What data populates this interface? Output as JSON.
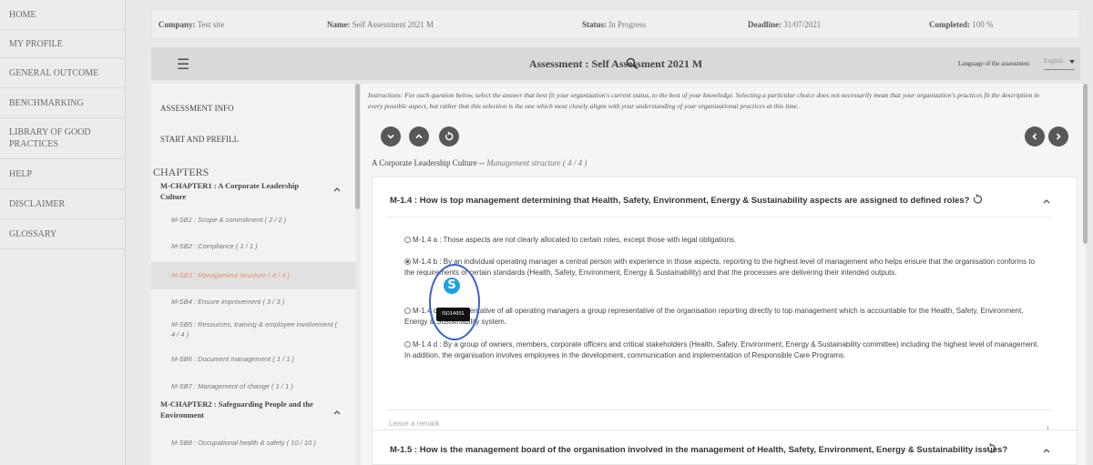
{
  "nav": {
    "items": [
      {
        "label": "HOME"
      },
      {
        "label": "MY PROFILE"
      },
      {
        "label": "GENERAL OUTCOME"
      },
      {
        "label": "BENCHMARKING"
      },
      {
        "label": "LIBRARY OF GOOD PRACTICES"
      },
      {
        "label": "HELP"
      },
      {
        "label": "DISCLAIMER"
      },
      {
        "label": "GLOSSARY"
      }
    ]
  },
  "info": {
    "company_label": "Company:",
    "company": "Test site",
    "name_label": "Name:",
    "name": "Self Assessment 2021 M",
    "status_label": "Status:",
    "status": "In Progress",
    "deadline_label": "Deadline:",
    "deadline": "31/07/2021",
    "completed_label": "Completed:",
    "completed": "100 %"
  },
  "header": {
    "title": "Assessment : Self Assessment 2021 M",
    "language_label": "Language of the assessment",
    "language_value": "English"
  },
  "sidebar": {
    "assessment_info": "ASSESSMENT INFO",
    "start_prefill": "START AND PREFILL",
    "chapters_heading": "CHAPTERS",
    "chapter1": "M-CHAPTER1 : A Corporate Leadership Culture",
    "sb_items": [
      "M-SB1 : Scope & commitment ( 2 / 2 )",
      "M-SB2 : Compliance ( 1 / 1 )",
      "M-SB3 : Management structure ( 4 / 4 )",
      "M-SB4 : Ensure improvement ( 3 / 3 )",
      "M-SB5 : Resources, training & employee involvement ( 4 / 4 )",
      "M-SB6 : Document management ( 1 / 1 )",
      "M-SB7 : Management of change ( 1 / 1 )"
    ],
    "active_sb_index": 2,
    "chapter2": "M-CHAPTER2 : Safeguarding People and the Environment",
    "sb8": "M-SB8 : Occupational health & safety ( 10 / 10 )"
  },
  "main": {
    "instructions": "Instructions: For each question below, select the answer that best fit your organization's current status, to the best of your knowledge. Selecting a particular choice does not necessarily mean that your organization's practices fit the description in every possible aspect, but rather that this selection is the one which most closely aligns with your understanding of your organizational practices at this time.",
    "breadcrumb_chapter": "A Corporate Leadership Culture --",
    "breadcrumb_section": "Management structure ( 4 / 4 )",
    "q1": {
      "title": "M-1.4 : How is top management determining that Health, Safety, Environment, Energy & Sustainability aspects are assigned to defined roles?",
      "options": [
        {
          "text": "M-1.4 a : Those aspects are not clearly allocated to certain roles, except those with legal obligations.",
          "selected": false
        },
        {
          "text": "M-1.4 b : By an individual operating manager a central person with experience in those aspects, reporting to the highest level of management who helps ensure that the organisation conforms to the requirements of certain standards (Health, Safety, Environment, Energy & Sustainability) and that the processes are delivering their intended outputs.",
          "selected": true
        },
        {
          "text": "M-1.4 c : A representative of all operating managers a group representative of the organisation reporting directly to top management which is accountable for the Health, Safety, Environment, Energy & Sustainability system.",
          "selected": false
        },
        {
          "text": "M-1.4 d : By a group of owners, members, corporate officers and critical stakeholders (Health, Safety, Environment, Energy & Sustainability committee) including the highest level of management. In addition, the organisation involves employees in the development, communication and implementation of Responsible Care Programs.",
          "selected": false
        }
      ],
      "remark_placeholder": "Leave a remark"
    },
    "q2": {
      "title": "M-1.5 : How is the management board of the organisation involved in the management of Health, Safety, Environment, Energy & Sustainability issues?"
    }
  },
  "overlay": {
    "skype_letter": "S",
    "tooltip": "ISO14001"
  },
  "colors": {
    "active_item": "#e9936b",
    "circle_button": "#585858",
    "highlight_ring": "#3a63c8",
    "skype_blue": "#1da1e2"
  }
}
